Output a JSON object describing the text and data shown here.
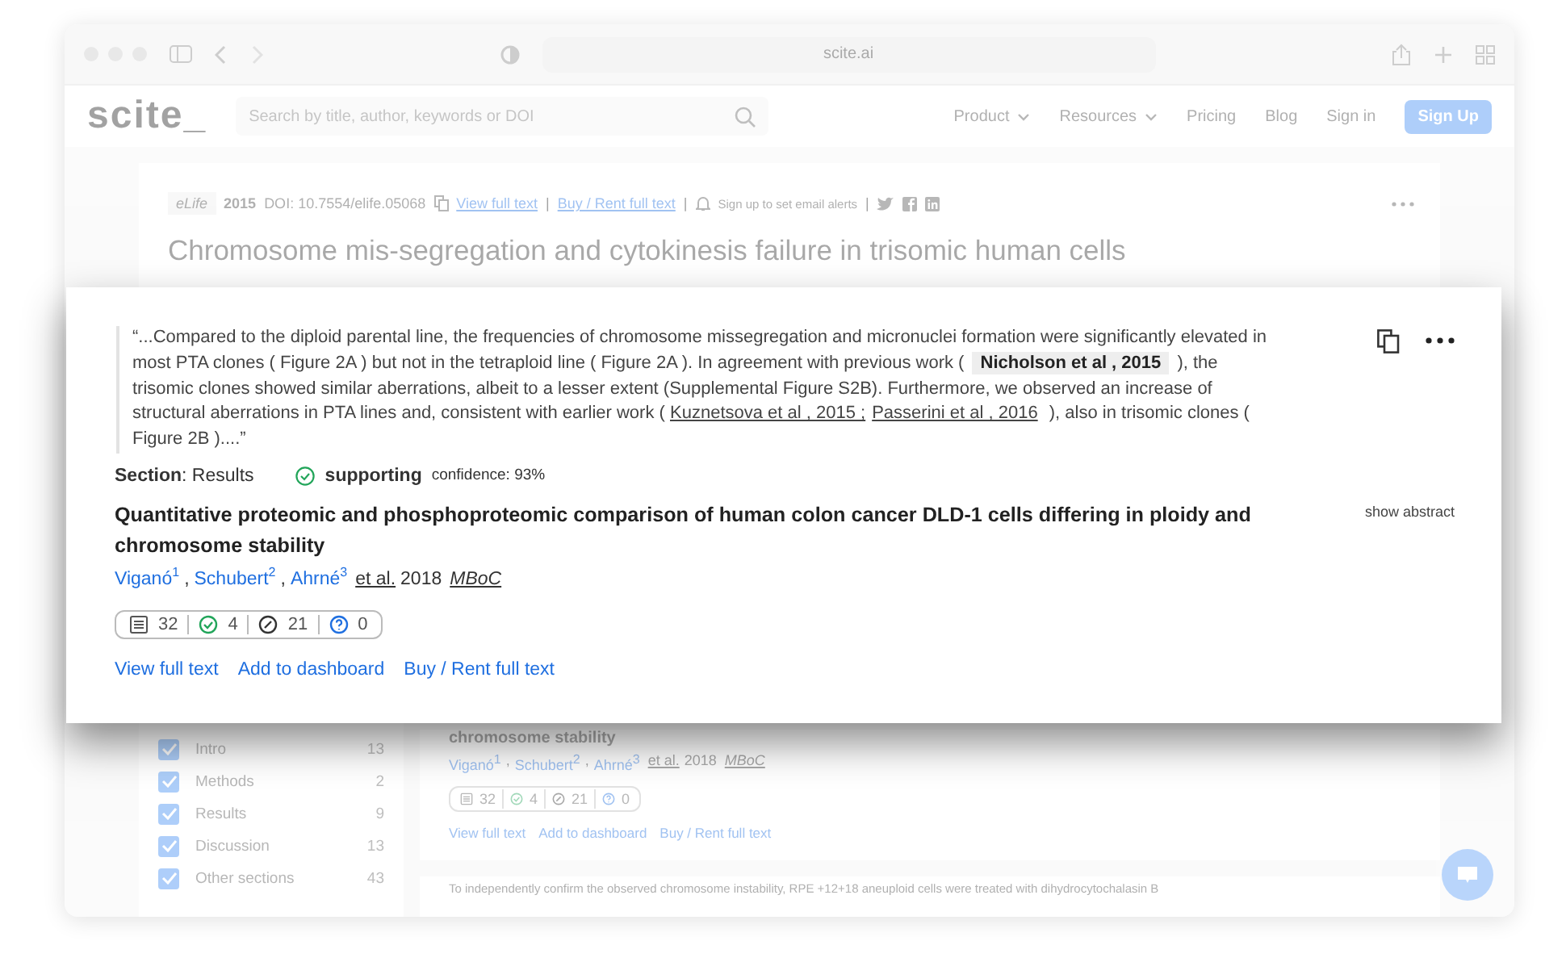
{
  "browser": {
    "url": "scite.ai"
  },
  "nav": {
    "logo": "scite_",
    "search_placeholder": "Search by title, author, keywords or DOI",
    "items": [
      {
        "label": "Product",
        "dropdown": true
      },
      {
        "label": "Resources",
        "dropdown": true
      },
      {
        "label": "Pricing",
        "dropdown": false
      },
      {
        "label": "Blog",
        "dropdown": false
      },
      {
        "label": "Sign in",
        "dropdown": false
      }
    ],
    "signup": "Sign Up"
  },
  "paper": {
    "journal": "eLife",
    "year": "2015",
    "doi": "DOI: 10.7554/elife.05068",
    "links": [
      "View full text",
      "Buy / Rent full text"
    ],
    "alerts": "Sign up to set email alerts",
    "separator": "|",
    "title": "Chromosome mis-segregation and cytokinesis failure in trisomic human cells"
  },
  "sections": [
    {
      "label": "Intro",
      "count": "13",
      "checked": true
    },
    {
      "label": "Methods",
      "count": "2",
      "checked": true
    },
    {
      "label": "Results",
      "count": "9",
      "checked": true
    },
    {
      "label": "Discussion",
      "count": "13",
      "checked": true
    },
    {
      "label": "Other sections",
      "count": "43",
      "checked": true
    }
  ],
  "background_citation": {
    "title_tail": "chromosome stability",
    "authors": [
      {
        "name": "Viganó",
        "sup": "1"
      },
      {
        "name": "Schubert",
        "sup": "2"
      },
      {
        "name": "Ahrné",
        "sup": "3"
      }
    ],
    "author_separator": ",",
    "etal": "et al.",
    "year": "2018",
    "journal": "MBoC",
    "counts": [
      {
        "kind": "document",
        "value": "32"
      },
      {
        "kind": "check",
        "value": "4"
      },
      {
        "kind": "slash",
        "value": "21"
      },
      {
        "kind": "question",
        "value": "0"
      }
    ],
    "links": [
      "View full text",
      "Add to dashboard",
      "Buy / Rent full text"
    ]
  },
  "next_citation": {
    "text": "To independently confirm the observed chromosome instability, RPE +12+18 aneuploid cells were treated with dihydrocytochalasin B"
  },
  "popup": {
    "quote": [
      {
        "kind": "text",
        "text": "“...Compared to the diploid parental line, the frequencies of chromosome missegregation and micronuclei formation were significantly elevated in most PTA clones ( Figure 2A ) but not in the tetraploid line ( Figure 2A ). In agreement with previous work ( "
      },
      {
        "kind": "chip",
        "text": "Nicholson et al , 2015"
      },
      {
        "kind": "text",
        "text": " ), the trisomic clones showed similar aberrations, albeit to a lesser extent (Supplemental Figure S2B). Furthermore, we observed an increase of structural aberrations in PTA lines and, consistent with earlier work ( "
      },
      {
        "kind": "link",
        "text": "Kuznetsova et al , 2015 ;"
      },
      {
        "kind": "link",
        "text": "Passerini et al , 2016"
      },
      {
        "kind": "text",
        "text": " ), also in trisomic clones ( Figure 2B )....”"
      }
    ],
    "section": "**Section**: Results",
    "classification": "supporting",
    "confidence": "confidence: 93%",
    "title": "Quantitative proteomic and phosphoproteomic comparison of human colon cancer DLD-1 cells differing in ploidy and chromosome stability",
    "show_abstract": "show abstract",
    "authors": [
      {
        "name": "Viganó",
        "sup": "1"
      },
      {
        "name": "Schubert",
        "sup": "2"
      },
      {
        "name": "Ahrné",
        "sup": "3"
      }
    ],
    "author_separator": ",",
    "etal": "et al.",
    "year": "2018",
    "journal": "MBoC",
    "counts": [
      {
        "kind": "document",
        "value": "32"
      },
      {
        "kind": "check",
        "value": "4"
      },
      {
        "kind": "slash",
        "value": "21"
      },
      {
        "kind": "question",
        "value": "0"
      }
    ],
    "links": [
      "View full text",
      "Add to dashboard",
      "Buy / Rent full text"
    ]
  }
}
